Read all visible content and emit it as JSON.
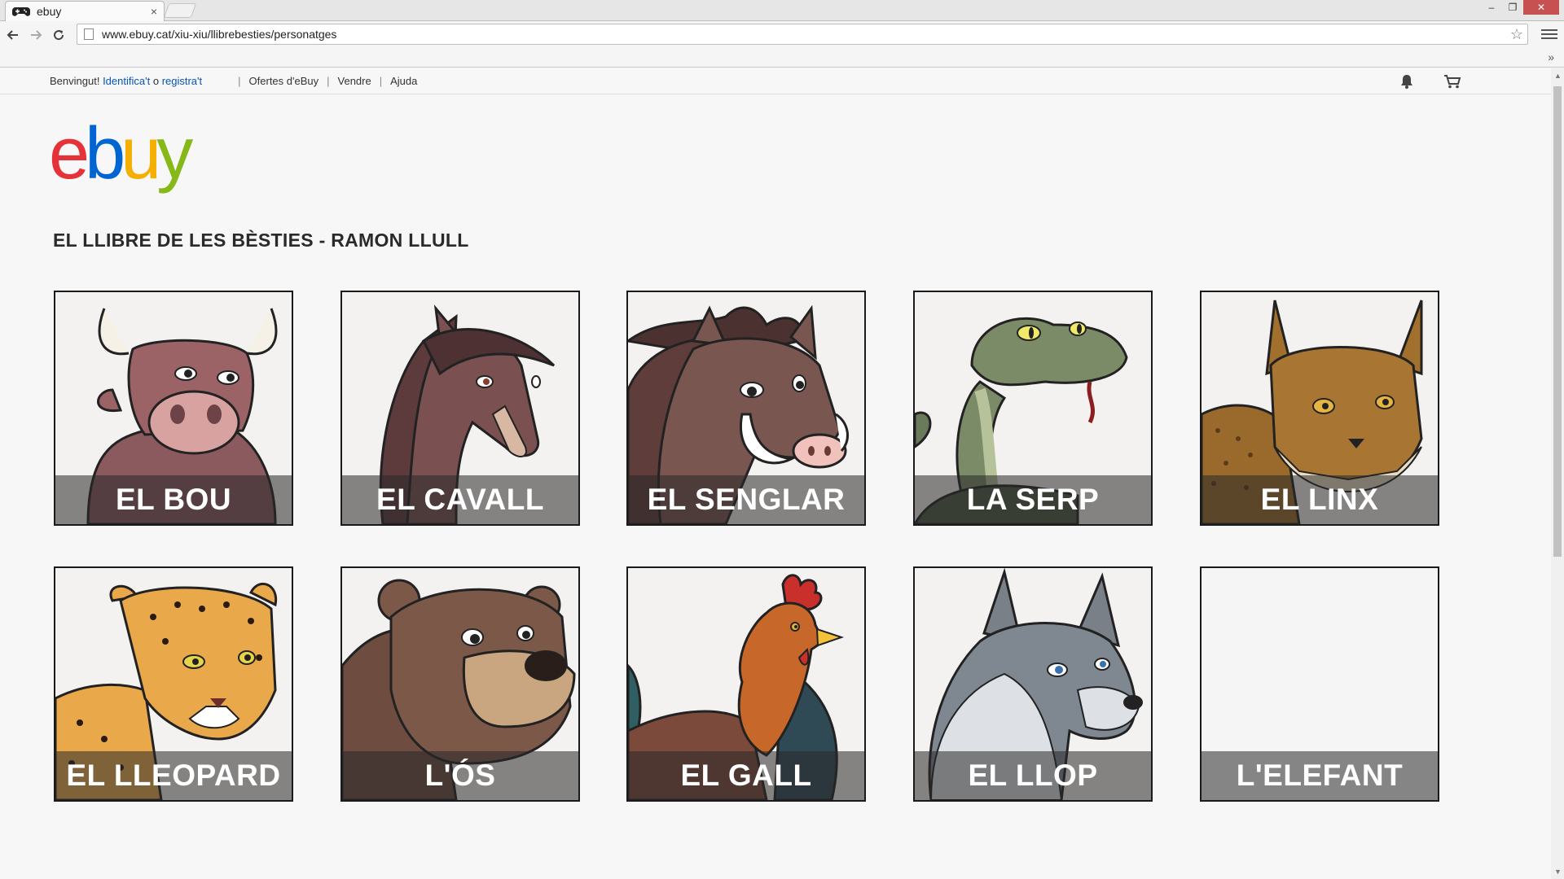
{
  "browser": {
    "tab_title": "ebuy",
    "tab_close": "×",
    "url": "www.ebuy.cat/xiu-xiu/llibrebesties/personatges",
    "win_minimize": "–",
    "win_restore": "❐",
    "win_close": "✕",
    "bookmarks_chevron": "»"
  },
  "topbar": {
    "welcome": "Benvingut!",
    "signin": "Identifica't",
    "or": "o",
    "register": "registra't",
    "links": [
      "Ofertes d'eBuy",
      "Vendre",
      "Ajuda"
    ],
    "icons": [
      "bell-icon",
      "cart-icon"
    ]
  },
  "logo": {
    "e": "e",
    "b": "b",
    "u": "u",
    "y": "y"
  },
  "page": {
    "title": "EL LLIBRE DE LES BÈSTIES - RAMON LLULL"
  },
  "characters": [
    {
      "name": "EL BOU",
      "art": "bull"
    },
    {
      "name": "EL CAVALL",
      "art": "horse"
    },
    {
      "name": "EL SENGLAR",
      "art": "boar"
    },
    {
      "name": "LA SERP",
      "art": "snake"
    },
    {
      "name": "EL LINX",
      "art": "lynx"
    },
    {
      "name": "EL LLEOPARD",
      "art": "leopard"
    },
    {
      "name": "L'ÓS",
      "art": "bear"
    },
    {
      "name": "EL GALL",
      "art": "rooster"
    },
    {
      "name": "EL LLOP",
      "art": "wolf"
    },
    {
      "name": "L'ELEFANT",
      "art": "none"
    }
  ],
  "colors": {
    "ebay_red": "#e53238",
    "ebay_blue": "#0064d2",
    "ebay_yellow": "#f5af02",
    "ebay_green": "#86b817",
    "link": "#0654ba"
  }
}
